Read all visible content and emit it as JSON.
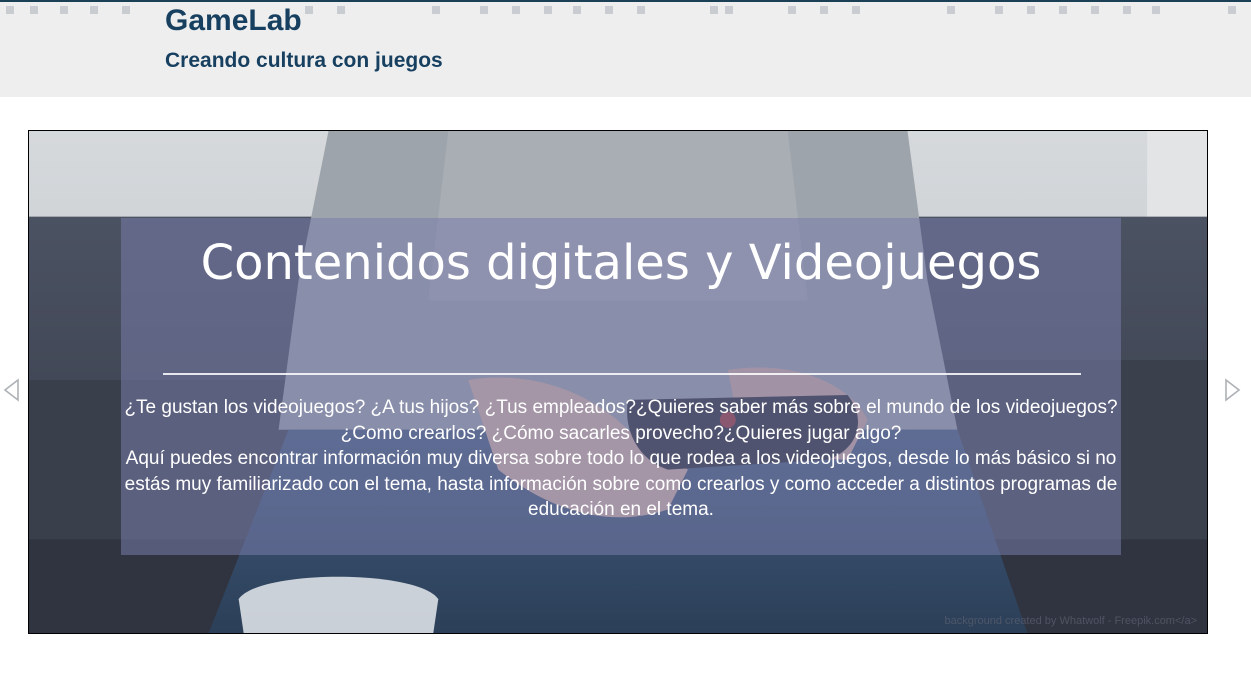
{
  "header": {
    "title": "GameLab",
    "subtitle": "Creando cultura con juegos"
  },
  "slider": {
    "slide_title": "Contenidos digitales y Videojuegos",
    "paragraph_1": "¿Te gustan los videojuegos? ¿A tus hijos? ¿Tus empleados?¿Quieres saber más sobre el mundo de los videojuegos? ¿Como crearlos? ¿Cómo sacarles provecho?¿Quieres jugar algo?",
    "paragraph_2": "Aquí puedes encontrar información muy diversa sobre todo lo que rodea a los videojuegos, desde lo más básico si no estás muy familiarizado con el tema, hasta información sobre como crearlos y como acceder a distintos programas de educación en el tema.",
    "image_credit": "background created by Whatwolf - Freepik.com</a>",
    "prev_icon": "triangle-left-icon",
    "next_icon": "triangle-right-icon"
  },
  "colors": {
    "brand_text": "#173f5f",
    "header_bg": "#eeeeee",
    "overlay": "#787caa"
  }
}
